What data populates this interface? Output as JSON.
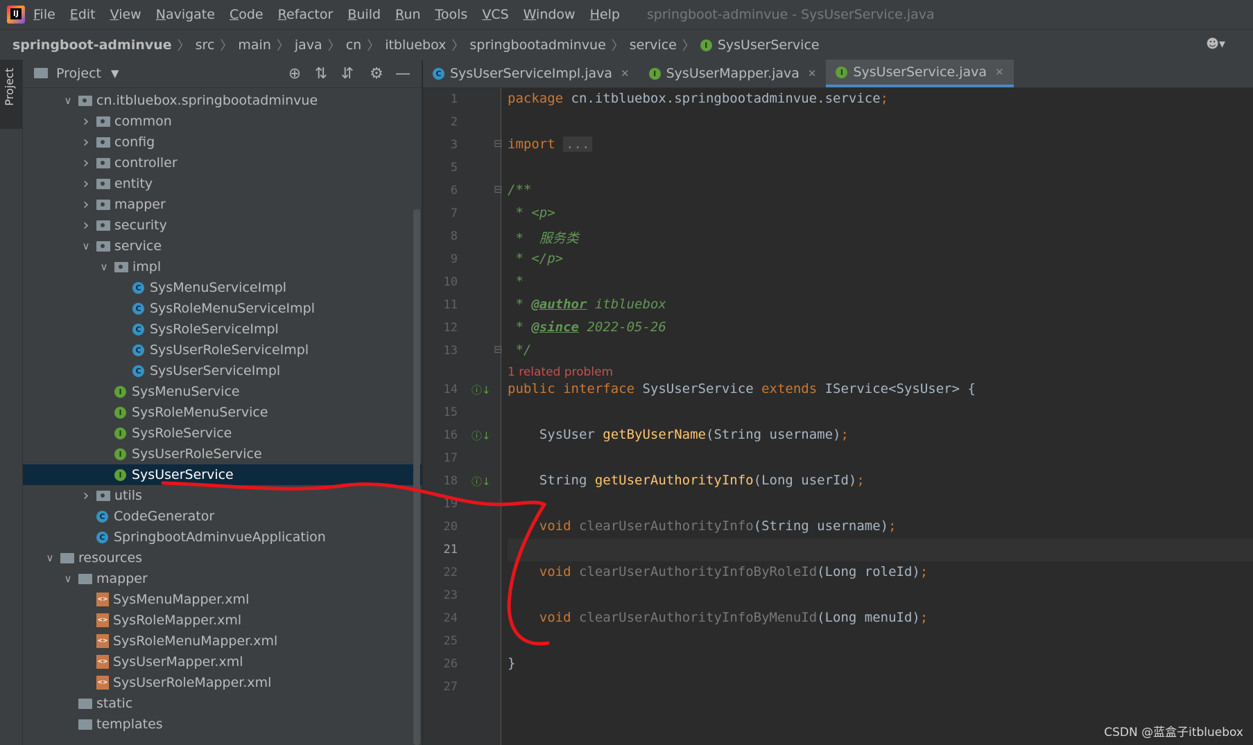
{
  "menubar": {
    "items": [
      "File",
      "Edit",
      "View",
      "Navigate",
      "Code",
      "Refactor",
      "Build",
      "Run",
      "Tools",
      "VCS",
      "Window",
      "Help"
    ],
    "window_title": "springboot-adminvue - SysUserService.java"
  },
  "breadcrumb": {
    "items": [
      "springboot-adminvue",
      "src",
      "main",
      "java",
      "cn",
      "itbluebox",
      "springbootadminvue",
      "service",
      "SysUserService"
    ]
  },
  "project_panel": {
    "title": "Project",
    "tree": [
      {
        "label": "cn.itbluebox.springbootadminvue",
        "level": 2,
        "kind": "package",
        "expanded": true
      },
      {
        "label": "common",
        "level": 3,
        "kind": "package",
        "expanded": false
      },
      {
        "label": "config",
        "level": 3,
        "kind": "package",
        "expanded": false
      },
      {
        "label": "controller",
        "level": 3,
        "kind": "package",
        "expanded": false
      },
      {
        "label": "entity",
        "level": 3,
        "kind": "package",
        "expanded": false
      },
      {
        "label": "mapper",
        "level": 3,
        "kind": "package",
        "expanded": false
      },
      {
        "label": "security",
        "level": 3,
        "kind": "package",
        "expanded": false
      },
      {
        "label": "service",
        "level": 3,
        "kind": "package",
        "expanded": true
      },
      {
        "label": "impl",
        "level": 4,
        "kind": "package",
        "expanded": true
      },
      {
        "label": "SysMenuServiceImpl",
        "level": 5,
        "kind": "class"
      },
      {
        "label": "SysRoleMenuServiceImpl",
        "level": 5,
        "kind": "class"
      },
      {
        "label": "SysRoleServiceImpl",
        "level": 5,
        "kind": "class"
      },
      {
        "label": "SysUserRoleServiceImpl",
        "level": 5,
        "kind": "class"
      },
      {
        "label": "SysUserServiceImpl",
        "level": 5,
        "kind": "class"
      },
      {
        "label": "SysMenuService",
        "level": 4,
        "kind": "interface"
      },
      {
        "label": "SysRoleMenuService",
        "level": 4,
        "kind": "interface"
      },
      {
        "label": "SysRoleService",
        "level": 4,
        "kind": "interface"
      },
      {
        "label": "SysUserRoleService",
        "level": 4,
        "kind": "interface"
      },
      {
        "label": "SysUserService",
        "level": 4,
        "kind": "interface",
        "selected": true
      },
      {
        "label": "utils",
        "level": 3,
        "kind": "package",
        "expanded": false
      },
      {
        "label": "CodeGenerator",
        "level": 3,
        "kind": "class"
      },
      {
        "label": "SpringbootAdminvueApplication",
        "level": 3,
        "kind": "class"
      },
      {
        "label": "resources",
        "level": 1,
        "kind": "resources",
        "expanded": true
      },
      {
        "label": "mapper",
        "level": 2,
        "kind": "folder",
        "expanded": true
      },
      {
        "label": "SysMenuMapper.xml",
        "level": 3,
        "kind": "xml"
      },
      {
        "label": "SysRoleMapper.xml",
        "level": 3,
        "kind": "xml"
      },
      {
        "label": "SysRoleMenuMapper.xml",
        "level": 3,
        "kind": "xml"
      },
      {
        "label": "SysUserMapper.xml",
        "level": 3,
        "kind": "xml"
      },
      {
        "label": "SysUserRoleMapper.xml",
        "level": 3,
        "kind": "xml"
      },
      {
        "label": "static",
        "level": 2,
        "kind": "folder-leaf"
      },
      {
        "label": "templates",
        "level": 2,
        "kind": "folder-leaf"
      }
    ]
  },
  "editor": {
    "tabs": [
      {
        "label": "SysUserServiceImpl.java",
        "kind": "class",
        "active": false
      },
      {
        "label": "SysUserMapper.java",
        "kind": "interface",
        "active": false
      },
      {
        "label": "SysUserService.java",
        "kind": "interface",
        "active": true
      }
    ],
    "problem_hint": "1 related problem",
    "current_line": "21",
    "lines": [
      {
        "n": "1",
        "text": "package cn.itbluebox.springbootadminvue.service;"
      },
      {
        "n": "2",
        "text": ""
      },
      {
        "n": "3",
        "text": "import ..."
      },
      {
        "n": "5",
        "text": ""
      },
      {
        "n": "6",
        "text": "/**"
      },
      {
        "n": "7",
        "text": " * <p>"
      },
      {
        "n": "8",
        "text": " *  服务类"
      },
      {
        "n": "9",
        "text": " * </p>"
      },
      {
        "n": "10",
        "text": " *"
      },
      {
        "n": "11",
        "text": " * @author itbluebox"
      },
      {
        "n": "12",
        "text": " * @since 2022-05-26"
      },
      {
        "n": "13",
        "text": " */"
      },
      {
        "n": "14",
        "text": "public interface SysUserService extends IService<SysUser> {"
      },
      {
        "n": "15",
        "text": ""
      },
      {
        "n": "16",
        "text": "    SysUser getByUserName(String username);"
      },
      {
        "n": "17",
        "text": ""
      },
      {
        "n": "18",
        "text": "    String getUserAuthorityInfo(Long userId);"
      },
      {
        "n": "19",
        "text": ""
      },
      {
        "n": "20",
        "text": "    void clearUserAuthorityInfo(String username);"
      },
      {
        "n": "21",
        "text": ""
      },
      {
        "n": "22",
        "text": "    void clearUserAuthorityInfoByRoleId(Long roleId);"
      },
      {
        "n": "23",
        "text": ""
      },
      {
        "n": "24",
        "text": "    void clearUserAuthorityInfoByMenuId(Long menuId);"
      },
      {
        "n": "25",
        "text": ""
      },
      {
        "n": "26",
        "text": "}"
      },
      {
        "n": "27",
        "text": ""
      }
    ]
  },
  "watermark": "CSDN @蓝盒子itbluebox",
  "colors": {
    "accent": "#4a88c7",
    "annotation": "#e8141a",
    "selection": "#0d293e"
  }
}
